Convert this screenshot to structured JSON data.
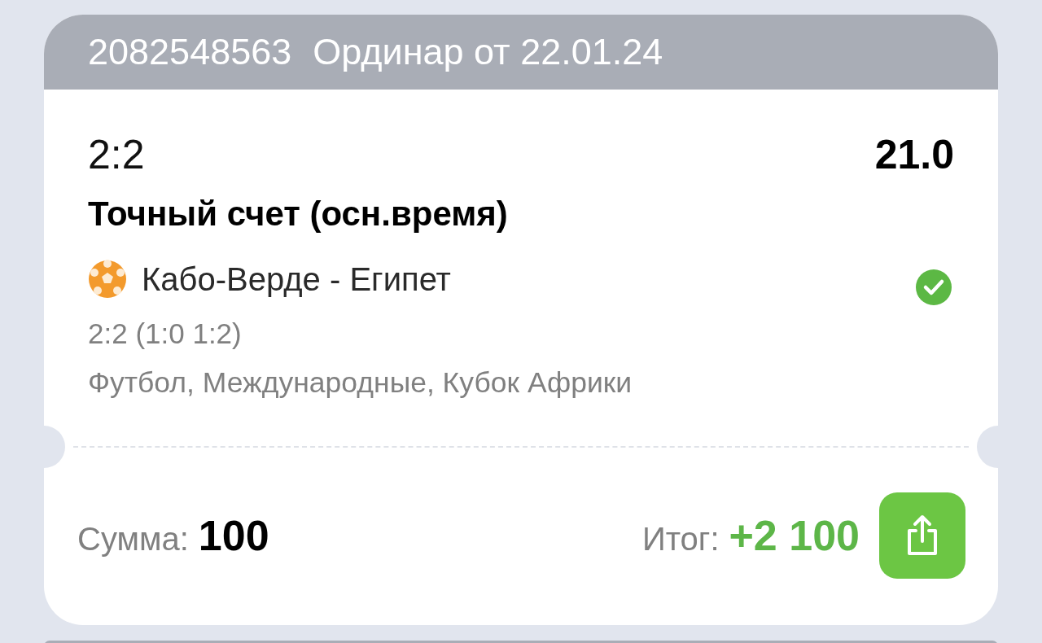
{
  "bet": {
    "number": "2082548563",
    "title": "Ординар от 22.01.24"
  },
  "selection": {
    "outcome": "2:2",
    "odds": "21.0",
    "market": "Точный счет (осн.время)",
    "event": "Кабо-Верде - Египет",
    "won": true,
    "result": "2:2 (1:0 1:2)",
    "tournament": "Футбол, Международные, Кубок Африки"
  },
  "footer": {
    "stake_label": "Сумма:",
    "stake": "100",
    "total_label": "Итог:",
    "total": "+2 100"
  }
}
